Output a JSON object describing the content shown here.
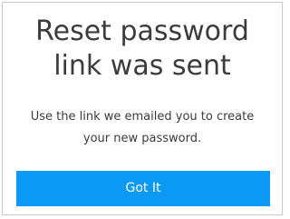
{
  "dialog": {
    "title_lines": [
      "Reset password",
      "link was sent"
    ],
    "message_lines": [
      "Use the link we emailed you to create",
      "your new password."
    ],
    "button_label": "Got It"
  },
  "colors": {
    "accent": "#0a99f5",
    "text": "#3c3c3c",
    "border": "#c9c9c9"
  }
}
